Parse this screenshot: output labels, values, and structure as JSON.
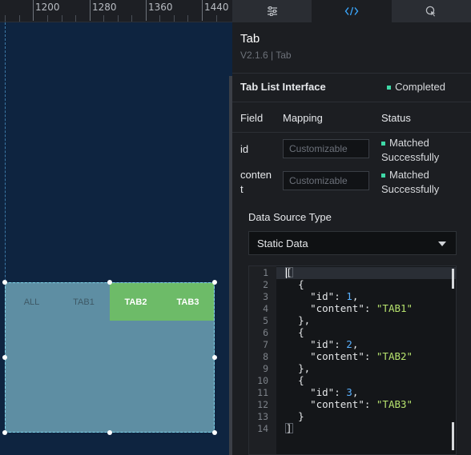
{
  "ruler": {
    "ticks": [
      "1200",
      "1280",
      "1360",
      "1440"
    ]
  },
  "tab_component": {
    "tabs": [
      {
        "label": "ALL",
        "active": false
      },
      {
        "label": "TAB1",
        "active": false
      },
      {
        "label": "TAB2",
        "active": true
      },
      {
        "label": "TAB3",
        "active": true
      }
    ],
    "active_color": "#6dbb68"
  },
  "panel": {
    "tabs": [
      {
        "icon": "sliders-icon"
      },
      {
        "icon": "code-icon",
        "active": true
      },
      {
        "icon": "interaction-icon"
      }
    ],
    "component": {
      "title": "Tab",
      "version": "V2.1.6 | Tab"
    },
    "interface": {
      "title": "Tab List Interface",
      "status": "Completed"
    },
    "mapping_headers": {
      "field": "Field",
      "mapping": "Mapping",
      "status": "Status"
    },
    "fields": [
      {
        "name": "id",
        "placeholder": "Customizable",
        "status_line1": "Matched",
        "status_line2": "Successfully"
      },
      {
        "name_line1": "conten",
        "name_line2": "t",
        "placeholder": "Customizable",
        "status_line1": "Matched",
        "status_line2": "Successfully"
      }
    ],
    "data_source": {
      "label": "Data Source Type",
      "selected": "Static Data"
    },
    "code": {
      "line_numbers": [
        "1",
        "2",
        "3",
        "4",
        "5",
        "6",
        "7",
        "8",
        "9",
        "10",
        "11",
        "12",
        "13",
        "14"
      ],
      "tokens": {
        "open_array": "[",
        "open_obj": "{",
        "id_key": "\"id\"",
        "content_key": "\"content\"",
        "colon": ": ",
        "comma": ",",
        "close_obj_comma": "},",
        "close_obj": "}",
        "close_array": "]",
        "id1": "1",
        "id2": "2",
        "id3": "3",
        "v1": "\"TAB1\"",
        "v2": "\"TAB2\"",
        "v3": "\"TAB3\""
      }
    },
    "status_color": "#3fd9a7"
  }
}
